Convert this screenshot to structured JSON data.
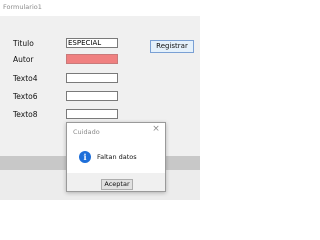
{
  "window": {
    "title": "Formulario1"
  },
  "form": {
    "fields": [
      {
        "label": "Titulo",
        "value": "ESPECIAL",
        "error": false
      },
      {
        "label": "Autor",
        "value": "",
        "error": true
      },
      {
        "label": "Texto4",
        "value": "",
        "error": false
      },
      {
        "label": "Texto6",
        "value": "",
        "error": false
      },
      {
        "label": "Texto8",
        "value": "",
        "error": false
      }
    ],
    "register_button": "Registrar"
  },
  "dialog": {
    "title": "Cuidado",
    "message": "Faltan datos",
    "icon": "info-icon",
    "ok_button": "Aceptar",
    "close_glyph": "×"
  },
  "colors": {
    "error_field": "#f08080",
    "info_icon": "#1e6fd9"
  }
}
